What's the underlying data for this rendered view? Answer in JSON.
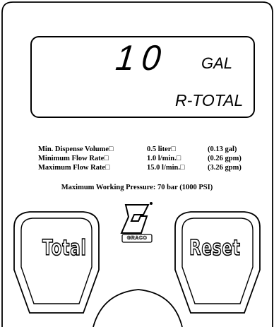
{
  "display": {
    "digits": "10",
    "unit": "GAL",
    "mode": "R-TOTAL"
  },
  "specs": {
    "rows": [
      {
        "label": "Min. Dispense Volume□",
        "metric": "0.5 liter□",
        "imperial": "(0.13 gal)"
      },
      {
        "label": "Minimum Flow Rate□",
        "metric": "1.0 l/min.□",
        "imperial": "(0.26 gpm)"
      },
      {
        "label": "Maximum Flow Rate□",
        "metric": "15.0 l/min.□",
        "imperial": "(3.26 gpm)"
      }
    ],
    "pressure": "Maximum Working Pressure: 70 bar (1000 PSI)"
  },
  "buttons": {
    "total_label": "Total",
    "reset_label": "Reset"
  },
  "logo": {
    "brand": "GRACO",
    "icon": "graco-logo-icon"
  },
  "colors": {
    "ink": "#000000",
    "background": "#ffffff"
  }
}
